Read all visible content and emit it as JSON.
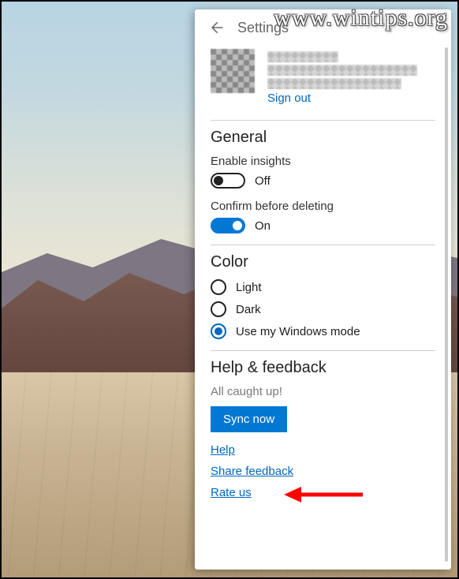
{
  "watermark": "www.wintips.org",
  "header": {
    "title": "Settings"
  },
  "account": {
    "signout": "Sign out"
  },
  "general": {
    "heading": "General",
    "insights_label": "Enable insights",
    "insights_state": "Off",
    "confirm_label": "Confirm before deleting",
    "confirm_state": "On"
  },
  "color": {
    "heading": "Color",
    "light": "Light",
    "dark": "Dark",
    "windows": "Use my Windows mode"
  },
  "help": {
    "heading": "Help & feedback",
    "status": "All caught up!",
    "sync": "Sync now",
    "help_link": "Help",
    "share_link": "Share feedback",
    "rate_link": "Rate us"
  }
}
